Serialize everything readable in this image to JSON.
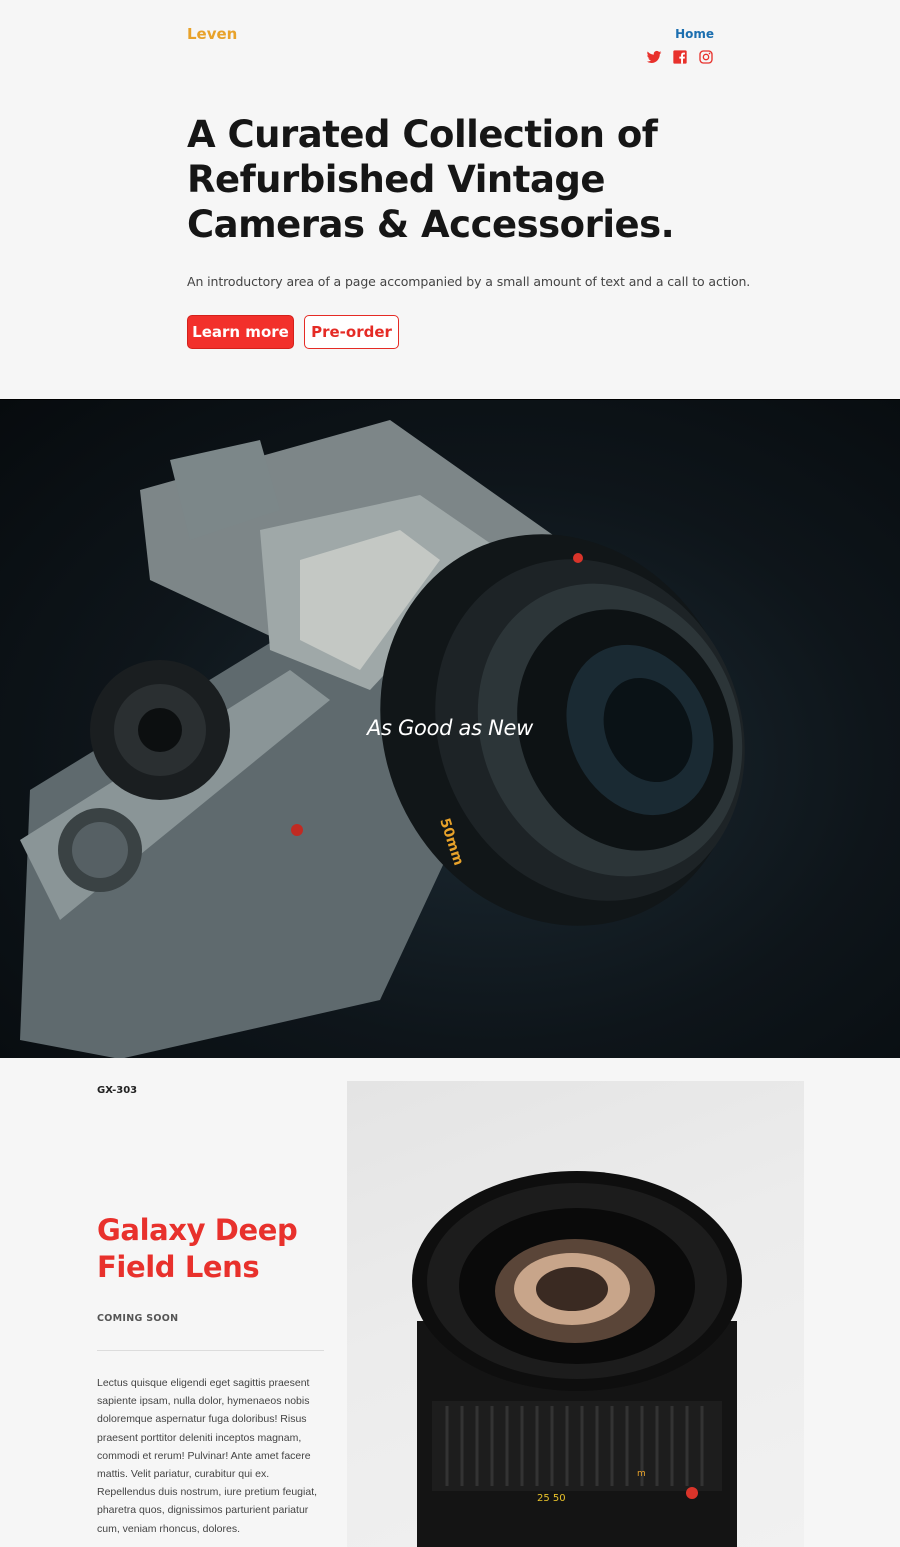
{
  "header": {
    "brand": "Leven",
    "nav_home": "Home",
    "social_icons": [
      "twitter-icon",
      "facebook-icon",
      "instagram-icon"
    ]
  },
  "hero": {
    "title": "A Curated Collection of Refurbished Vintage Cameras & Accessories.",
    "subtitle": "An introductory area of a page accompanied by a small amount of text and a call to action.",
    "primary_button": "Learn more",
    "secondary_button": "Pre-order"
  },
  "banner": {
    "caption": "As Good as New"
  },
  "product": {
    "sku": "GX-303",
    "title": "Galaxy Deep Field Lens",
    "status": "COMING SOON",
    "description": "Lectus quisque eligendi eget sagittis praesent sapiente ipsam, nulla dolor, hymenaeos nobis doloremque aspernatur fuga doloribus! Risus praesent porttitor deleniti inceptos magnam, commodi et rerum! Pulvinar! Ante amet facere mattis. Velit pariatur, curabitur qui ex. Repellendus duis nostrum, iure pretium feugiat, pharetra quos, dignissimos parturient pariatur cum, veniam rhoncus, dolores."
  },
  "colors": {
    "brand": "#e8a22a",
    "link": "#1c6fb0",
    "accent_red": "#f2302b",
    "product_title": "#e8312c"
  }
}
